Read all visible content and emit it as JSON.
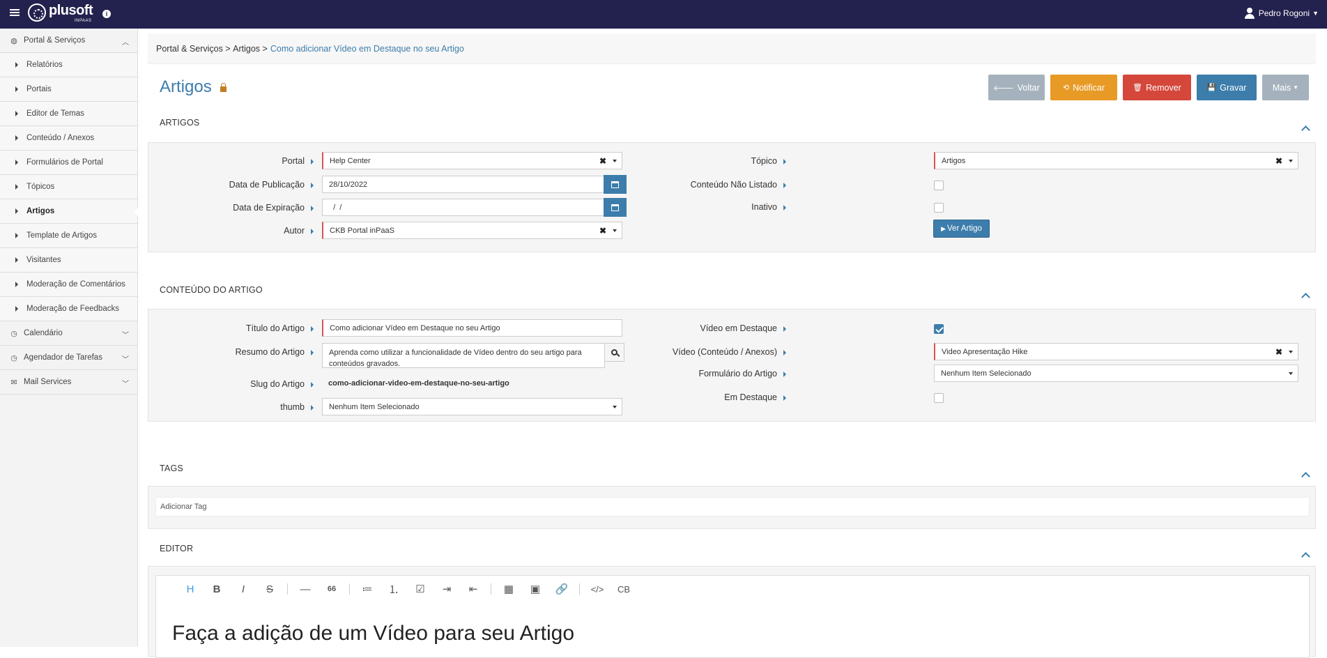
{
  "app": {
    "brand": "plusoft",
    "brand_sub": "INPAAS",
    "user_name": "Pedro Rogoni"
  },
  "sidebar": {
    "items": [
      {
        "label": "Portal & Serviços",
        "kind": "top",
        "icon": "globe-icon",
        "expanded": true
      },
      {
        "label": "Relatórios",
        "kind": "sub"
      },
      {
        "label": "Portais",
        "kind": "sub"
      },
      {
        "label": "Editor de Temas",
        "kind": "sub"
      },
      {
        "label": "Conteúdo / Anexos",
        "kind": "sub"
      },
      {
        "label": "Formulários de Portal",
        "kind": "sub"
      },
      {
        "label": "Tópicos",
        "kind": "sub"
      },
      {
        "label": "Artigos",
        "kind": "sub",
        "active": true
      },
      {
        "label": "Template de Artigos",
        "kind": "sub"
      },
      {
        "label": "Visitantes",
        "kind": "sub"
      },
      {
        "label": "Moderação de Comentários",
        "kind": "sub"
      },
      {
        "label": "Moderação de Feedbacks",
        "kind": "sub"
      },
      {
        "label": "Calendário",
        "kind": "top",
        "icon": "clock-icon"
      },
      {
        "label": "Agendador de Tarefas",
        "kind": "top",
        "icon": "clock-icon"
      },
      {
        "label": "Mail Services",
        "kind": "top",
        "icon": "envelope-icon"
      }
    ]
  },
  "breadcrumb": {
    "part1": "Portal & Serviços",
    "sep": ">",
    "part2": "Artigos",
    "current": "Como adicionar Vídeo em Destaque no seu Artigo"
  },
  "page": {
    "title": "Artigos"
  },
  "toolbar": {
    "voltar": "Voltar",
    "notificar": "Notificar",
    "remover": "Remover",
    "gravar": "Gravar",
    "mais": "Mais",
    "colors": {
      "voltar": "#a5b2bd",
      "notificar": "#e89a26",
      "remover": "#d4473a",
      "gravar": "#3c7dab",
      "mais": "#a5b2bd"
    }
  },
  "artigos": {
    "heading": "ARTIGOS",
    "portal_label": "Portal",
    "portal_value": "Help Center",
    "pub_label": "Data de Publicação",
    "pub_value": "28/10/2022",
    "exp_label": "Data de Expiração",
    "exp_value": "  /  /",
    "autor_label": "Autor",
    "autor_value": "CKB Portal inPaaS",
    "topico_label": "Tópico",
    "topico_value": "Artigos",
    "nao_listado_label": "Conteúdo Não Listado",
    "inativo_label": "Inativo",
    "ver_artigo": "Ver Artigo"
  },
  "conteudo": {
    "heading": "CONTEÚDO DO ARTIGO",
    "titulo_label": "Título do Artigo",
    "titulo_value": "Como adicionar Vídeo em Destaque no seu Artigo",
    "resumo_label": "Resumo do Artigo",
    "resumo_value": "Aprenda como utilizar a funcionalidade de Vídeo dentro do seu artigo para conteúdos gravados.",
    "slug_label": "Slug do Artigo",
    "slug_value": "como-adicionar-video-em-destaque-no-seu-artigo",
    "thumb_label": "thumb",
    "thumb_value": "Nenhum Item Selecionado",
    "video_destaque_label": "Vídeo em Destaque",
    "video_label": "Vídeo (Conteúdo / Anexos)",
    "video_value": "Video Apresentação Hike",
    "form_label": "Formulário do Artigo",
    "form_value": "Nenhum Item Selecionado",
    "em_destaque_label": "Em Destaque"
  },
  "tags": {
    "heading": "TAGS",
    "placeholder": "Adicionar Tag"
  },
  "editor": {
    "heading": "EDITOR",
    "tools": [
      "H",
      "B",
      "I",
      "S",
      "—",
      "66",
      "≔",
      "⒈",
      "☑",
      "⇥",
      "⇤",
      "▦",
      "▣",
      "🔗",
      "</>",
      "CB"
    ],
    "content_heading": "Faça a adição de um Vídeo para seu Artigo"
  }
}
